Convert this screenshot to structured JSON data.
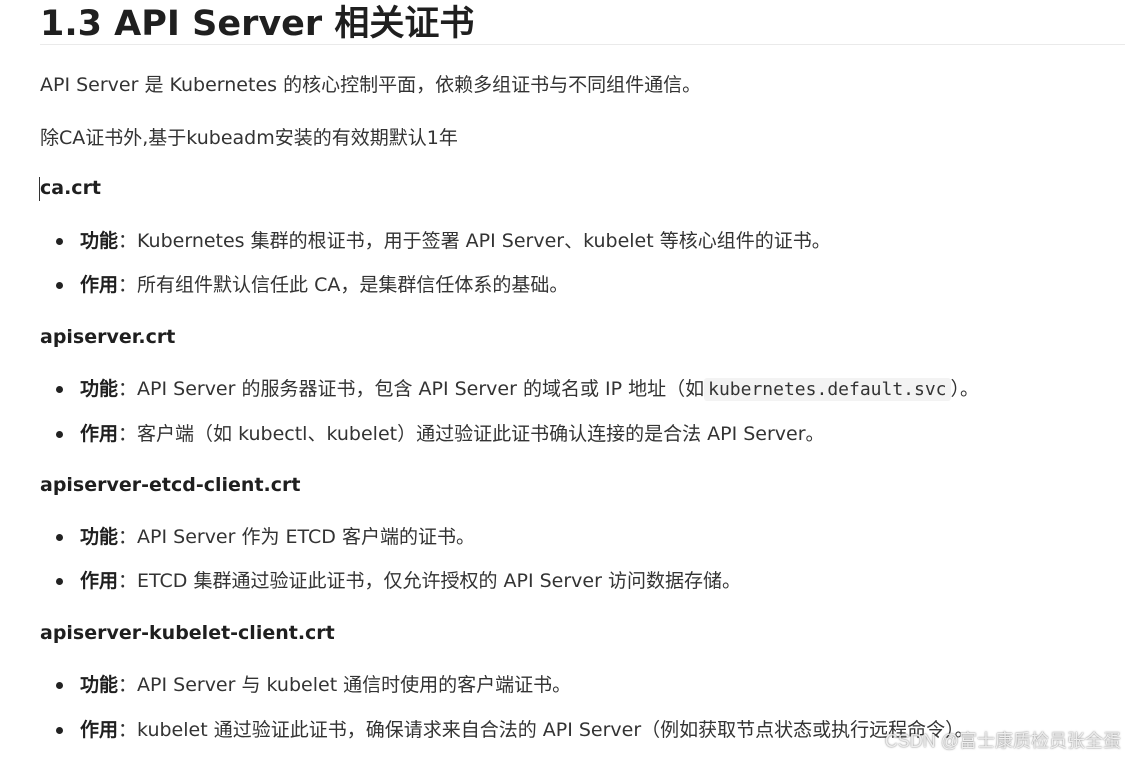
{
  "heading": "1.3 API Server 相关证书",
  "intro": "API Server 是 Kubernetes 的核心控制平面，依赖多组证书与不同组件通信。",
  "validity_note": "除CA证书外,基于kubeadm安装的有效期默认1年",
  "sections": [
    {
      "title": "ca.crt",
      "items": [
        {
          "label": "功能",
          "sep": "：",
          "text": "Kubernetes 集群的根证书，用于签署 API Server、kubelet 等核心组件的证书。"
        },
        {
          "label": "作用",
          "sep": "：",
          "text": "所有组件默认信任此 CA，是集群信任体系的基础。"
        }
      ]
    },
    {
      "title": "apiserver.crt",
      "items": [
        {
          "label": "功能",
          "sep": "：",
          "text_before": "API Server 的服务器证书，包含 API Server 的域名或 IP 地址（如",
          "code": "kubernetes.default.svc",
          "text_after": "）。"
        },
        {
          "label": "作用",
          "sep": "：",
          "text": "客户端（如 kubectl、kubelet）通过验证此证书确认连接的是合法 API Server。"
        }
      ]
    },
    {
      "title": "apiserver-etcd-client.crt",
      "items": [
        {
          "label": "功能",
          "sep": "：",
          "text": "API Server 作为 ETCD 客户端的证书。"
        },
        {
          "label": "作用",
          "sep": "：",
          "text": "ETCD 集群通过验证此证书，仅允许授权的 API Server 访问数据存储。"
        }
      ]
    },
    {
      "title": "apiserver-kubelet-client.crt",
      "items": [
        {
          "label": "功能",
          "sep": "：",
          "text": "API Server 与 kubelet 通信时使用的客户端证书。"
        },
        {
          "label": "作用",
          "sep": "：",
          "text": "kubelet 通过验证此证书，确保请求来自合法的 API Server（例如获取节点状态或执行远程命令）。"
        }
      ]
    }
  ],
  "watermark": "CSDN @富士康质检员张全蛋"
}
